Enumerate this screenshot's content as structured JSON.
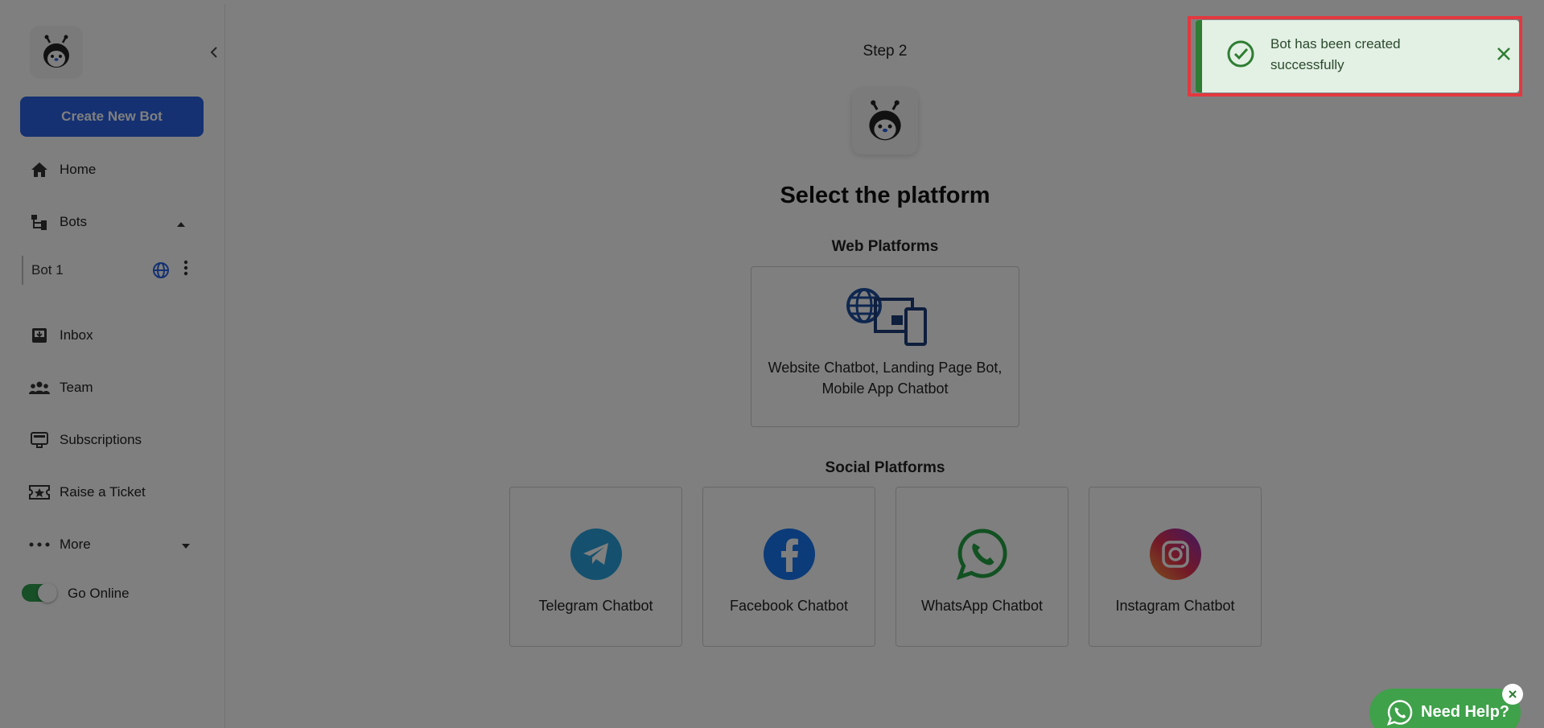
{
  "sidebar": {
    "create_button": "Create New Bot",
    "nav": {
      "home": "Home",
      "bots": "Bots",
      "inbox": "Inbox",
      "team": "Team",
      "subscriptions": "Subscriptions",
      "ticket": "Raise a Ticket",
      "more": "More"
    },
    "bot_item": "Bot 1",
    "toggle_label": "Go Online"
  },
  "main": {
    "step": "Step 2",
    "title": "Select the platform",
    "web_heading": "Web Platforms",
    "web_card_line1": "Website Chatbot, Landing Page Bot,",
    "web_card_line2": "Mobile App Chatbot",
    "social_heading": "Social Platforms",
    "social": {
      "telegram": "Telegram Chatbot",
      "facebook": "Facebook Chatbot",
      "whatsapp": "WhatsApp Chatbot",
      "instagram": "Instagram Chatbot"
    }
  },
  "toast": {
    "message": "Bot has been created successfully"
  },
  "help": {
    "label": "Need Help?"
  },
  "colors": {
    "primary": "#2a62e4",
    "success": "#2e7d32",
    "highlight": "#e3383f",
    "telegram": "#2aa3dc",
    "facebook": "#1877f2",
    "whatsapp": "#25a244"
  }
}
